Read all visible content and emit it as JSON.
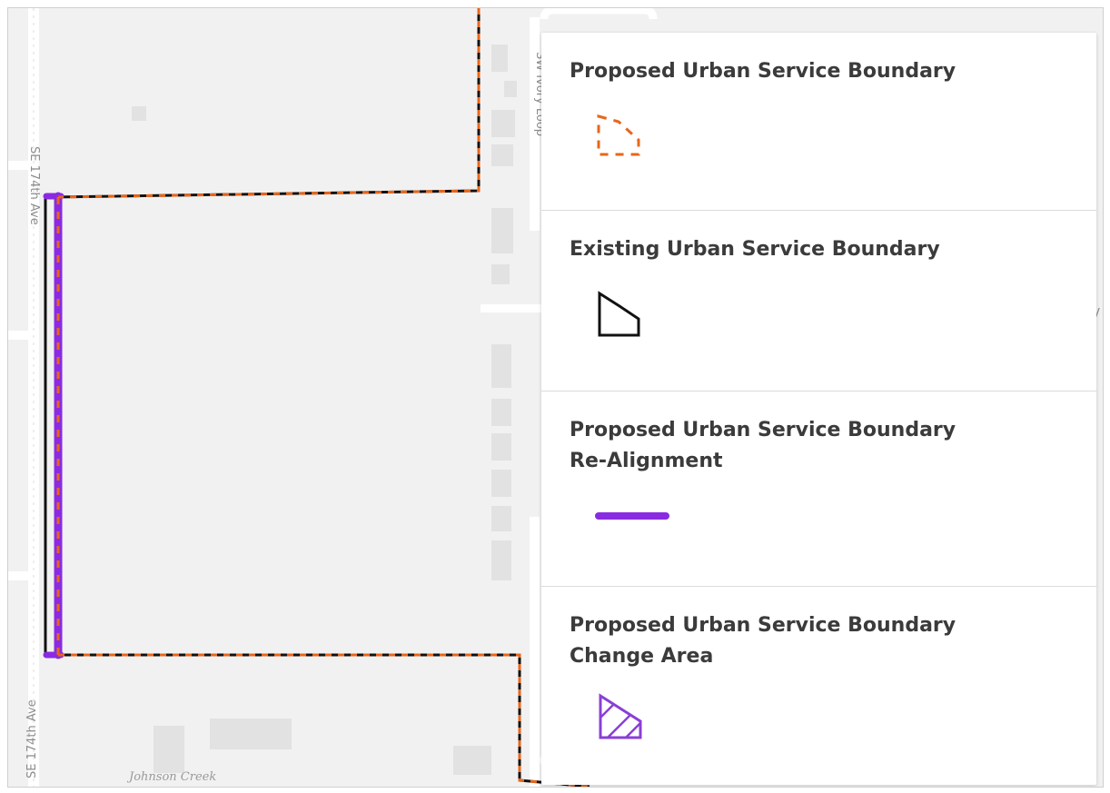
{
  "map": {
    "street_labels": [
      "SE 174th Ave",
      "SE 174th Ave",
      "SW Ivory Loop"
    ],
    "place_labels": [
      "Johnson Creek"
    ],
    "edge_letter": "V"
  },
  "legend": {
    "items": [
      {
        "title": "Proposed Urban Service Boundary",
        "icon": "dashed-orange-polygon-icon",
        "color": "#e8661a"
      },
      {
        "title": "Existing Urban Service Boundary",
        "icon": "black-outline-polygon-icon",
        "color": "#111111"
      },
      {
        "title_lines": [
          "Proposed Urban Service Boundary",
          "Re-Alignment"
        ],
        "icon": "purple-line-icon",
        "color": "#8a2be2"
      },
      {
        "title_lines": [
          "Proposed Urban Service Boundary",
          "Change Area"
        ],
        "icon": "hatched-purple-polygon-icon",
        "color": "#8a3fd6"
      }
    ]
  },
  "colors": {
    "map_background": "#f1f1f1",
    "roads": "#ffffff",
    "buildings": "#e2e2e2",
    "proposed_boundary": "#e8661a",
    "existing_boundary": "#111111",
    "realignment": "#8a2be2"
  }
}
